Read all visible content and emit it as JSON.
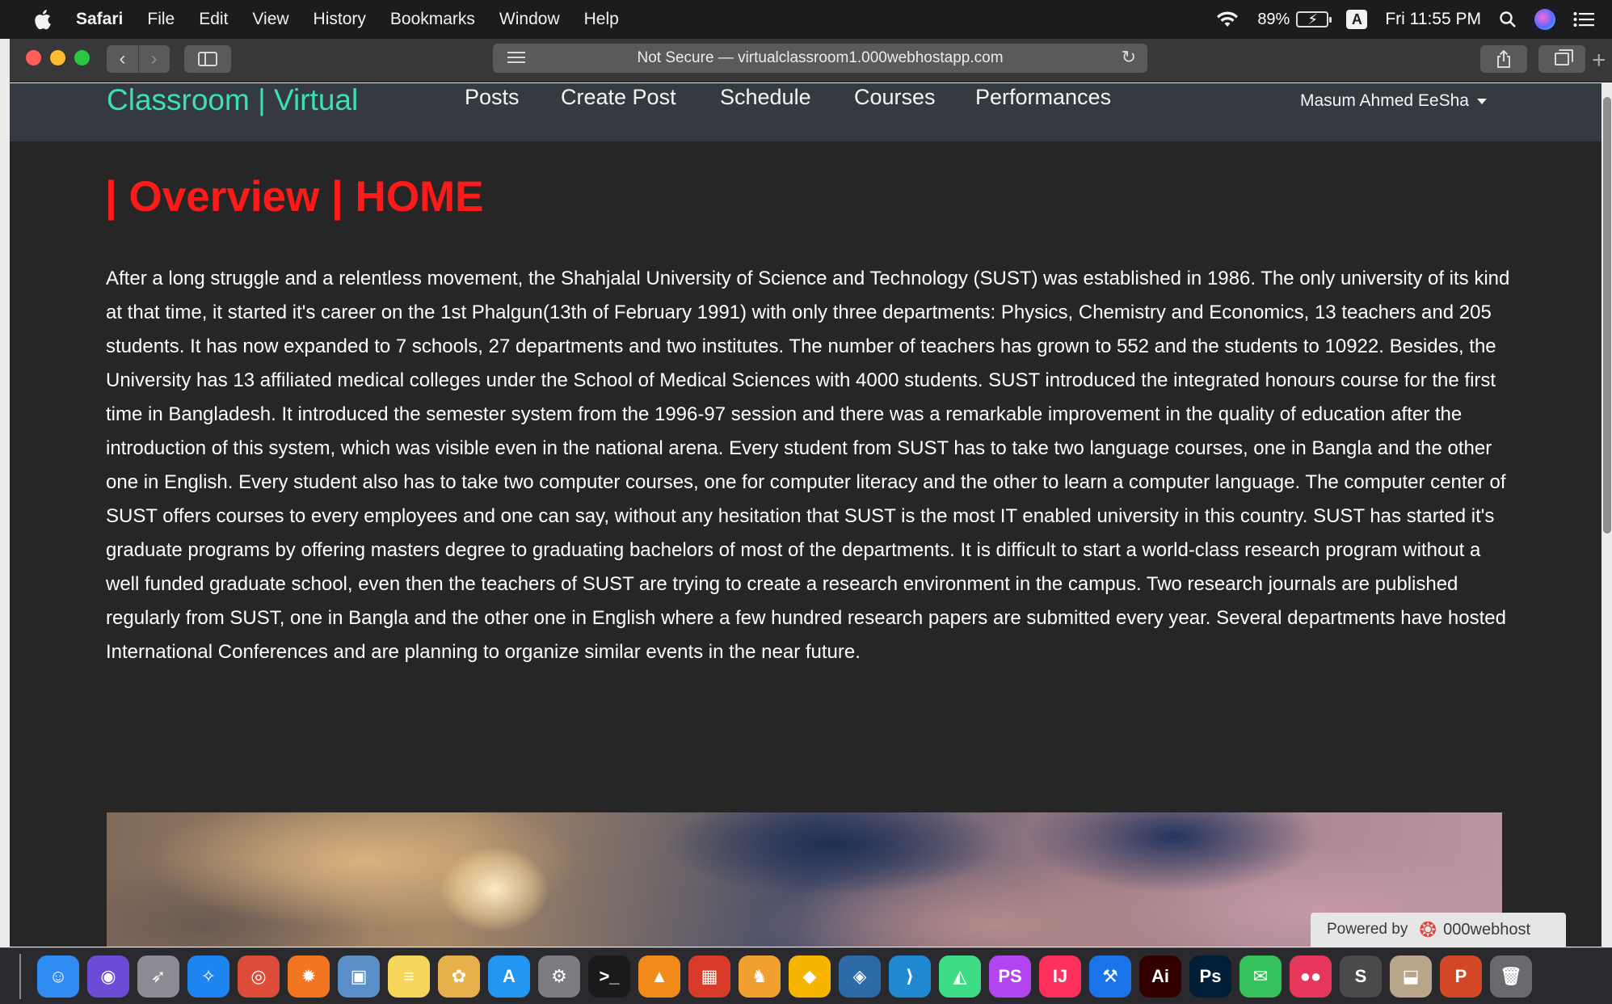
{
  "menubar": {
    "app": "Safari",
    "items": [
      "File",
      "Edit",
      "View",
      "History",
      "Bookmarks",
      "Window",
      "Help"
    ],
    "battery": "89%",
    "input_source": "A",
    "clock": "Fri 11:55 PM"
  },
  "browser": {
    "address": "Not Secure — virtualclassroom1.000webhostapp.com"
  },
  "site": {
    "brand": "Classroom | Virtual",
    "nav": [
      "Posts",
      "Create Post",
      "Schedule",
      "Courses",
      "Performances"
    ],
    "user": "Masum Ahmed EeSha"
  },
  "content": {
    "title": "| Overview | HOME",
    "body": "After a long struggle and a relentless movement, the Shahjalal University of Science and Technology (SUST) was established in 1986. The only university of its kind at that time, it started it's career on the 1st Phalgun(13th of February 1991) with only three departments: Physics, Chemistry and Economics, 13 teachers and 205 students. It has now expanded to 7 schools, 27 departments and two institutes. The number of teachers has grown to 552 and the students to 10922. Besides, the University has 13 affiliated medical colleges under the School of Medical Sciences with 4000 students. SUST introduced the integrated honours course for the first time in Bangladesh. It introduced the semester system from the 1996-97 session and there was a remarkable improvement in the quality of education after the introduction of this system, which was visible even in the national arena. Every student from SUST has to take two language courses, one in Bangla and the other one in English. Every student also has to take two computer courses, one for computer literacy and the other to learn a computer language. The computer center of SUST offers courses to every employees and one can say, without any hesitation that SUST is the most IT enabled university in this country. SUST has started it's graduate programs by offering masters degree to graduating bachelors of most of the departments. It is difficult to start a world-class research program without a well funded graduate school, even then the teachers of SUST are trying to create a research environment in the campus. Two research journals are published regularly from SUST, one in Bangla and the other one in English where a few hundred research papers are submitted every year. Several departments have hosted International Conferences and are planning to organize similar events in the near future."
  },
  "badge": {
    "powered_by": "Powered by",
    "host": "000webhost"
  },
  "dock": [
    {
      "name": "finder",
      "glyph": "☺",
      "color": "#2f8cf2"
    },
    {
      "name": "siri",
      "glyph": "◉",
      "color": "#6a4cd6"
    },
    {
      "name": "launchpad",
      "glyph": "➶",
      "color": "#8c8c94"
    },
    {
      "name": "safari",
      "glyph": "✧",
      "color": "#1e84f0"
    },
    {
      "name": "chrome",
      "glyph": "◎",
      "color": "#dd4b39"
    },
    {
      "name": "firefox",
      "glyph": "✹",
      "color": "#f27522"
    },
    {
      "name": "preview",
      "glyph": "▣",
      "color": "#5a8fc8"
    },
    {
      "name": "notes",
      "glyph": "≡",
      "color": "#f5d65a"
    },
    {
      "name": "photos",
      "glyph": "✿",
      "color": "#e8b04a"
    },
    {
      "name": "app-store",
      "glyph": "A",
      "color": "#2196f3"
    },
    {
      "name": "system-preferences",
      "glyph": "⚙",
      "color": "#7c7c80"
    },
    {
      "name": "terminal",
      "glyph": ">_",
      "color": "#1a1a1a"
    },
    {
      "name": "vlc",
      "glyph": "▲",
      "color": "#f28b1a"
    },
    {
      "name": "office",
      "glyph": "▦",
      "color": "#d83b2a"
    },
    {
      "name": "tableplus",
      "glyph": "♞",
      "color": "#f0a030"
    },
    {
      "name": "sketch",
      "glyph": "◆",
      "color": "#f7b500"
    },
    {
      "name": "mysql-workbench",
      "glyph": "◈",
      "color": "#2c6aa8"
    },
    {
      "name": "vscode",
      "glyph": "⟩",
      "color": "#1f8ad2"
    },
    {
      "name": "android-studio",
      "glyph": "◭",
      "color": "#3ddc84"
    },
    {
      "name": "phpstorm",
      "glyph": "PS",
      "color": "#b345f1"
    },
    {
      "name": "intellij",
      "glyph": "IJ",
      "color": "#fe315d"
    },
    {
      "name": "xcode",
      "glyph": "⚒",
      "color": "#1b73e8"
    },
    {
      "name": "illustrator",
      "glyph": "Ai",
      "color": "#330000"
    },
    {
      "name": "photoshop",
      "glyph": "Ps",
      "color": "#001e36"
    },
    {
      "name": "messages",
      "glyph": "✉",
      "color": "#36c25a"
    },
    {
      "name": "flickr",
      "glyph": "●●",
      "color": "#e6365a"
    },
    {
      "name": "sublime-text",
      "glyph": "S",
      "color": "#4a4a4a"
    },
    {
      "name": "archive-utility",
      "glyph": "⬓",
      "color": "#b8a58a"
    },
    {
      "name": "powerpoint",
      "glyph": "P",
      "color": "#d24726"
    },
    {
      "name": "trash",
      "glyph": "🗑",
      "color": "#6a6a6e"
    }
  ]
}
